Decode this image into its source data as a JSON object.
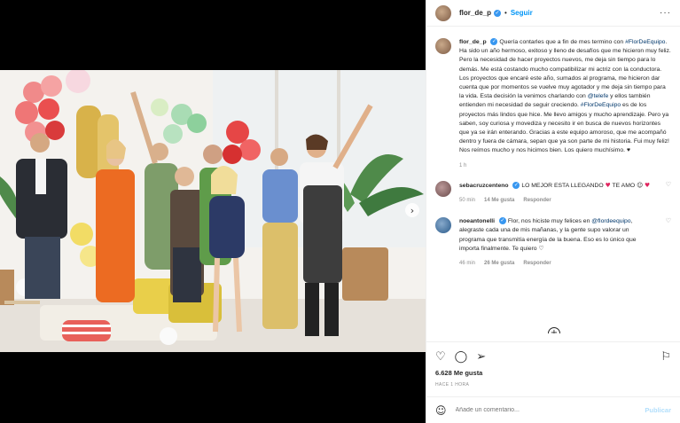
{
  "post": {
    "username": "flor_de_p",
    "follow_label": "Seguir",
    "more_icon": "more-horizontal-icon",
    "caption_text": "Quería contarles que a fin de mes termino con",
    "caption_tag1": "#FlorDeEquipo",
    "caption_text2": ". Ha sido un año hermoso, exitoso y lleno de desafíos que me hicieron muy feliz. Pero la necesidad de hacer proyectos nuevos, me deja sin tiempo para lo demás. Me está costando mucho compatibilizar mi actriz con la conductora. Los proyectos que encaré este año, sumados al programa, me hicieron dar cuenta que por momentos se vuelve muy agotador y me deja sin tiempo para la vida. Esta decisión la venimos charlando con",
    "caption_tag2": "@telefe",
    "caption_text3": "y ellos también entienden mi necesidad de seguir creciendo.",
    "caption_tag3": "#FlorDeEquipo",
    "caption_text4": "es de los proyectos más lindos que hice. Me llevo amigos y mucho aprendizaje. Pero ya saben, soy curiosa y movediza y necesito ir en busca de nuevos horizontes que ya se irán enterando. Gracias a este equipo amoroso, que me acompañó dentro y fuera de cámara, sepan que ya son parte de mi historia. Fui muy feliz! Nos reímos mucho y nos hicimos bien. Los quiero muchísimo. ♥",
    "caption_age": "1 h"
  },
  "comments": [
    {
      "username": "sebacruzcenteno",
      "text": "LO MEJOR ESTA LLEGANDO",
      "text_after": "TE AMO",
      "age": "50 min",
      "likes": "14 Me gusta",
      "reply": "Responder"
    },
    {
      "username": "noeantonelli",
      "text1": "Flor, nos hiciste muy felices en",
      "tag": "@flordeequipo",
      "text2": ", alegraste cada una de mis mañanas, y la gente supo valorar un programa que transmitía energía de la buena. Eso es lo único que importa finalmente. Te quiero ♡",
      "age": "46 min",
      "likes": "26 Me gusta",
      "reply": "Responder"
    }
  ],
  "footer": {
    "likes_count": "6.628 Me gusta",
    "time_ago": "HACE 1 HORA",
    "comment_placeholder": "Añade un comentario...",
    "publish_label": "Publicar"
  },
  "icons": {
    "heart": "heart-icon",
    "comment": "comment-icon",
    "share": "share-icon",
    "save": "bookmark-icon",
    "emoji": "emoji-icon",
    "load_more": "plus-circle-icon",
    "next": "chevron-right-icon"
  }
}
